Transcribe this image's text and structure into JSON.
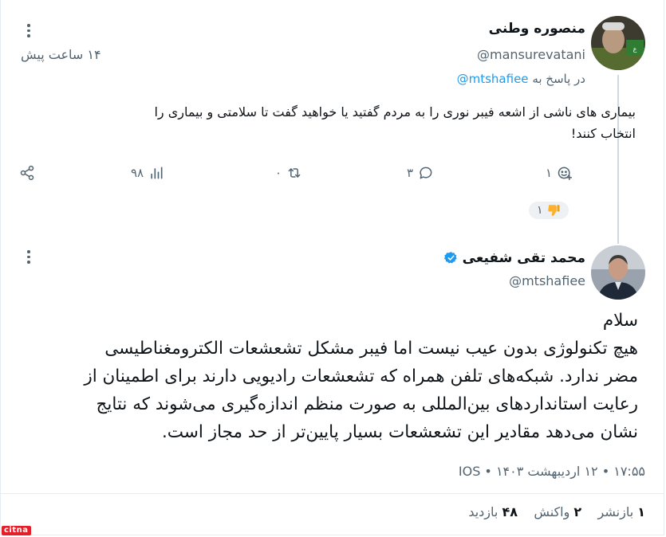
{
  "reply_tweet": {
    "author_name": "منصوره وطنی",
    "author_handle": "@mansurevatani",
    "timestamp": "۱۴ ساعت پیش",
    "reply_prefix": "در پاسخ به",
    "reply_to_handle": "@mtshafiee",
    "text_line1": "بیماری های ناشی از اشعه فیبر نوری را به مردم گفتید یا خواهید گفت تا سلامتی و بیماری را",
    "text_line2": "انتخاب کنند!",
    "actions": {
      "share_icon": "share-icon",
      "views": "۹۸",
      "views_icon": "bar-chart-icon",
      "retweets": "۰",
      "retweets_icon": "retweet-icon",
      "replies": "۳",
      "replies_icon": "reply-icon",
      "reactions": "۱",
      "reactions_icon": "add-reaction-icon"
    },
    "reaction_pill": {
      "count": "۱",
      "emoji": "👎"
    }
  },
  "main_tweet": {
    "author_name": "محمد تقی شفیعی",
    "author_handle": "@mtshafiee",
    "verified": true,
    "greeting": "سلام",
    "body_lines": [
      "هیچ تکنولوژی بدون عیب نیست اما فیبر مشکل تشعشعات الکترومغناطیسی",
      "مضر ندارد. شبکه‌های تلفن همراه که تشعشعات رادیویی دارند برای اطمینان از",
      "رعایت استانداردهای بین‌المللی به صورت منظم اندازه‌گیری می‌شوند که نتایج",
      "نشان می‌دهد مقادیر این تشعشعات بسیار پایین‌تر از حد مجاز است."
    ],
    "meta": "۱۷:۵۵ • ۱۲ اردیبهشت ۱۴۰۳ • IOS",
    "stats": {
      "reposts_num": "۱",
      "reposts_label": "بازنشر",
      "reactions_num": "۲",
      "reactions_label": "واکنش",
      "views_num": "۴۸",
      "views_label": "بازدید"
    }
  },
  "watermark": "CITNA",
  "colors": {
    "accent": "#1d9bf0",
    "muted": "#536471",
    "text": "#0f1419",
    "watermark": "#e3202a"
  }
}
